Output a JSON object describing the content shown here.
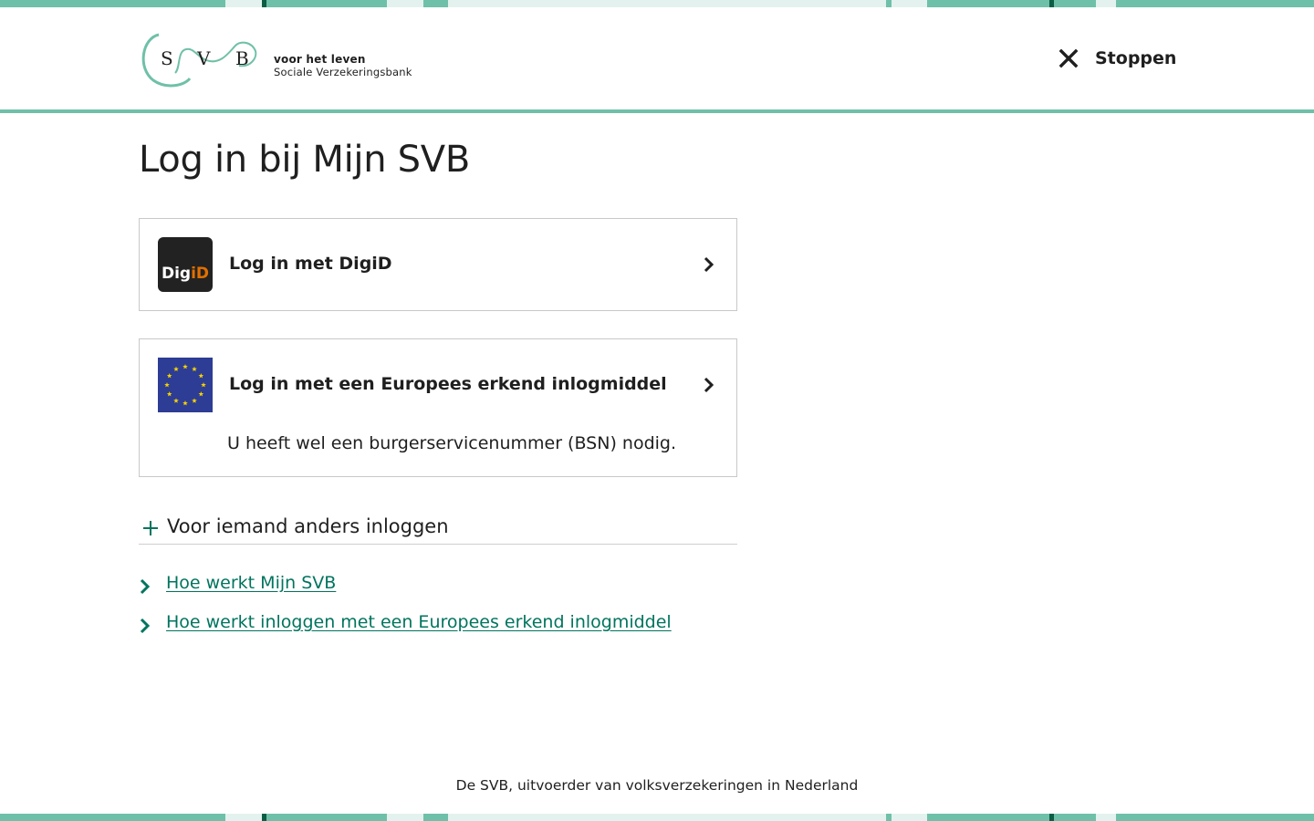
{
  "colors": {
    "brand_green": "#6fc0a8",
    "brand_dark_green": "#0b5d44",
    "brand_pale_green": "#e3f2ee",
    "link": "#00745e",
    "digid_orange": "#e17000",
    "eu_blue": "#2d3c94",
    "eu_star": "#f5d300"
  },
  "header": {
    "logo_letters": [
      "S",
      "V",
      "B"
    ],
    "tagline_1": "voor het leven",
    "tagline_2": "Sociale Verzekeringsbank",
    "stop_icon": "close-icon",
    "stop_label": "Stoppen"
  },
  "page_title": "Log in bij Mijn SVB",
  "login_options": [
    {
      "icon": "digid-logo",
      "logo_text_a": "Dig",
      "logo_text_b": "iD",
      "label": "Log in met DigiD",
      "chevron": "chevron-right-icon"
    },
    {
      "icon": "eu-flag-icon",
      "label": "Log in met een Europees erkend inlogmiddel",
      "note": "U heeft wel een burgerservicenummer (BSN) nodig.",
      "chevron": "chevron-right-icon"
    }
  ],
  "toggle": {
    "icon": "plus-icon",
    "label": "Voor iemand anders inloggen"
  },
  "links": [
    {
      "icon": "chevron-right-icon",
      "label": "Hoe werkt Mijn SVB"
    },
    {
      "icon": "chevron-right-icon",
      "label": "Hoe werkt inloggen met een Europees erkend inlogmiddel"
    }
  ],
  "footer": "De SVB, uitvoerder van volksverzekeringen in Nederland"
}
